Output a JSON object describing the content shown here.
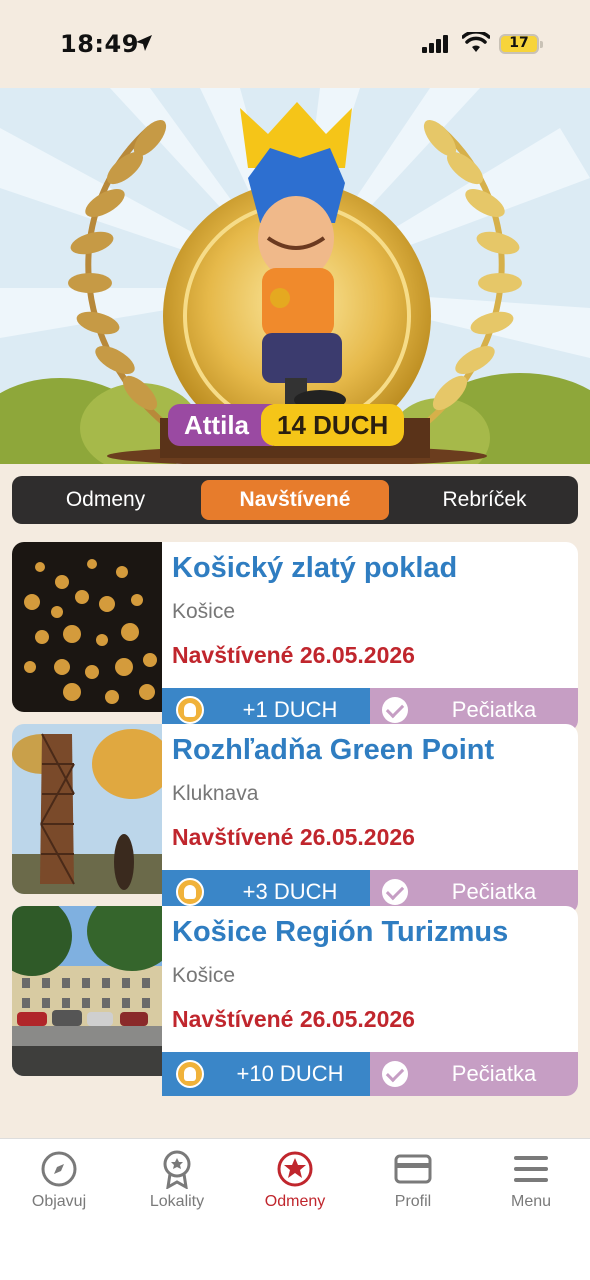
{
  "status_bar": {
    "time": "18:49",
    "battery": "17"
  },
  "hero": {
    "user_name": "Attila",
    "points": "14 DUCH"
  },
  "tabs": [
    {
      "label": "Odmeny",
      "active": false
    },
    {
      "label": "Navštívené",
      "active": true
    },
    {
      "label": "Rebríček",
      "active": false
    }
  ],
  "cards": [
    {
      "title": "Košický zlatý poklad",
      "city": "Košice",
      "visited": "Navštívené 26.05.2026",
      "points": "+1 DUCH",
      "stamp": "Pečiatka"
    },
    {
      "title": "Rozhľadňa Green Point",
      "city": "Kluknava",
      "visited": "Navštívené 26.05.2026",
      "points": "+3 DUCH",
      "stamp": "Pečiatka"
    },
    {
      "title": "Košice Región Turizmus",
      "city": "Košice",
      "visited": "Navštívené 26.05.2026",
      "points": "+10 DUCH",
      "stamp": "Pečiatka"
    }
  ],
  "nav": [
    {
      "label": "Objavuj",
      "icon": "compass-icon"
    },
    {
      "label": "Lokality",
      "icon": "badge-star-icon"
    },
    {
      "label": "Odmeny",
      "icon": "star-circle-icon",
      "active": true
    },
    {
      "label": "Profil",
      "icon": "card-icon"
    },
    {
      "label": "Menu",
      "icon": "hamburger-icon"
    }
  ],
  "colors": {
    "accent": "#e77c2c",
    "title_blue": "#2f7dc1",
    "visited_red": "#c0262d",
    "points_blue": "#3a86c8",
    "stamp_purple": "#c69ec4"
  }
}
